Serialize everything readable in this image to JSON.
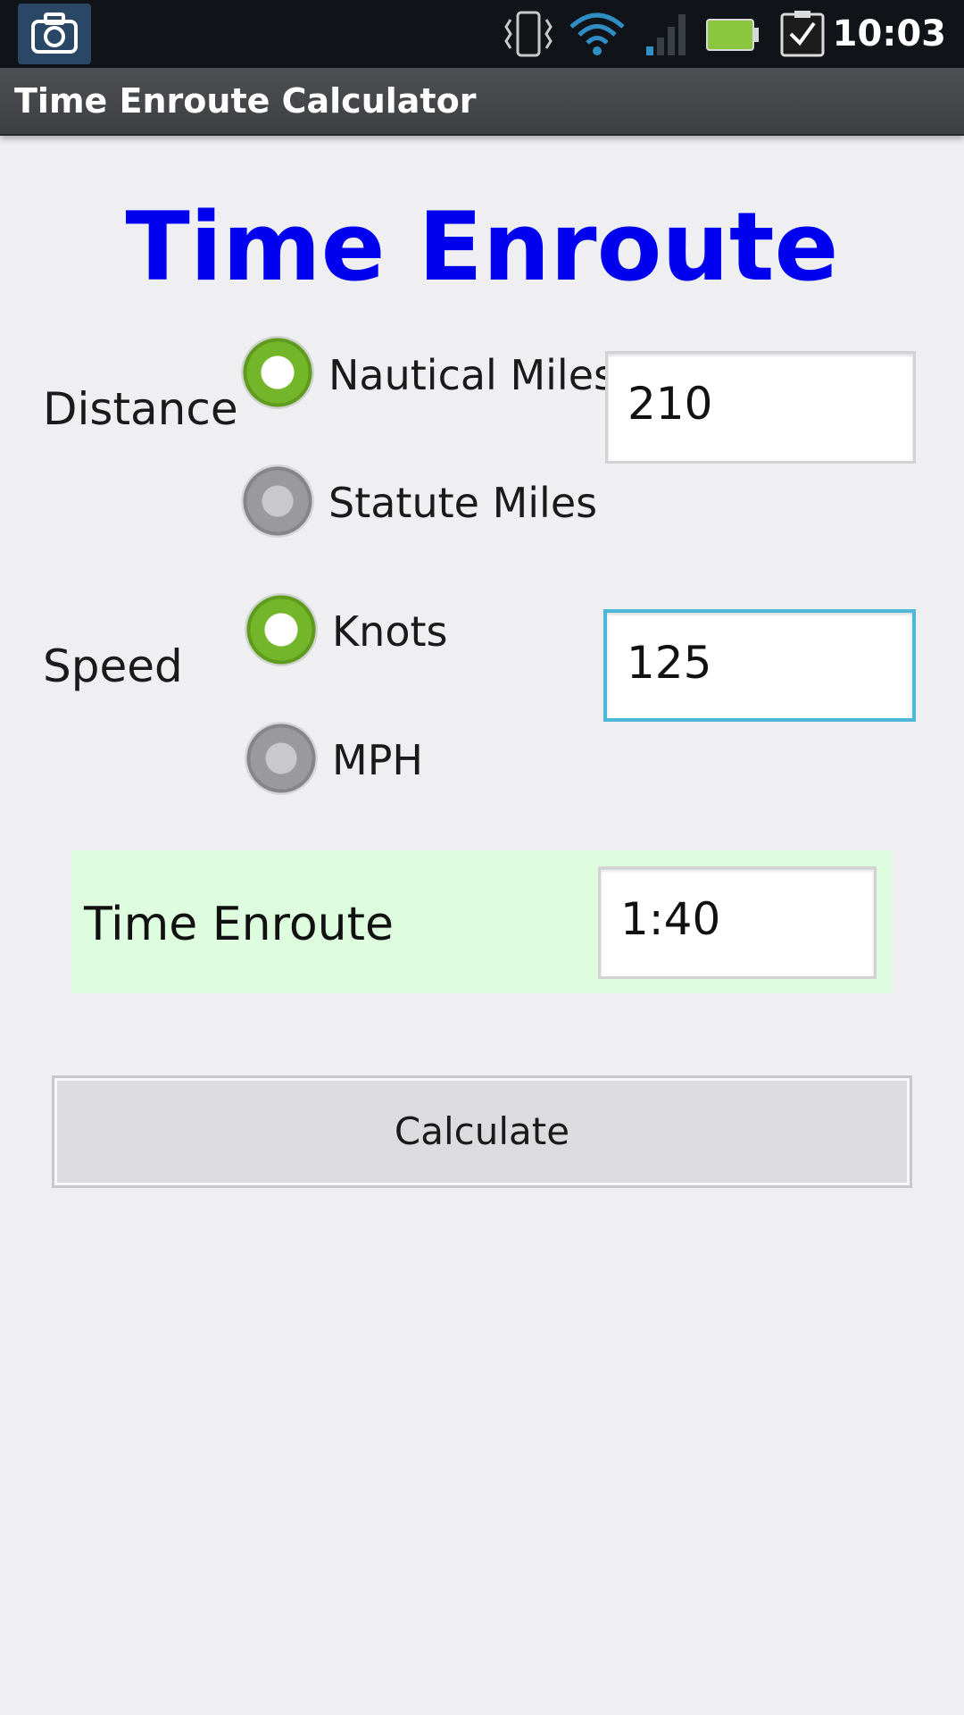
{
  "status_bar": {
    "time": "10:03",
    "icons": [
      "camera-icon",
      "vibrate-icon",
      "wifi-icon",
      "signal-icon",
      "battery-icon",
      "task-check-icon"
    ]
  },
  "app": {
    "title": "Time Enroute Calculator"
  },
  "main": {
    "heading": "Time Enroute",
    "distance": {
      "label": "Distance",
      "options": [
        {
          "label": "Nautical Miles",
          "selected": true
        },
        {
          "label": "Statute Miles",
          "selected": false
        }
      ],
      "value": "210"
    },
    "speed": {
      "label": "Speed",
      "options": [
        {
          "label": "Knots",
          "selected": true
        },
        {
          "label": "MPH",
          "selected": false
        }
      ],
      "value": "125"
    },
    "result": {
      "label": "Time Enroute",
      "value": "1:40"
    },
    "calculate_label": "Calculate"
  },
  "colors": {
    "heading": "#0000ee",
    "radio_selected": "#74b62a",
    "radio_unselected": "#9a9a9d",
    "focus_border": "#4fb7d8",
    "result_background": "#ddfdde",
    "background": "#efeff2"
  }
}
